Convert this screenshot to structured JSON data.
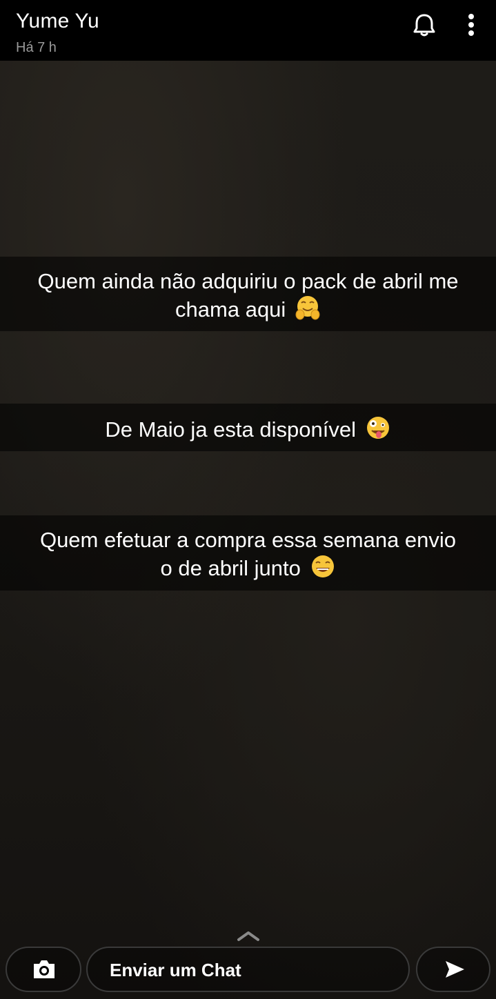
{
  "header": {
    "user_name": "Yume Yu",
    "timestamp": "Há 7 h",
    "icons": [
      "bell-icon",
      "more-vertical-icon"
    ]
  },
  "captions": [
    {
      "line1": "Quem ainda não adquiriu o pack de abril me",
      "line2": "chama aqui",
      "emoji": "hugging-face-emoji"
    },
    {
      "line1": "De Maio ja esta disponível",
      "emoji": "zany-face-emoji"
    },
    {
      "line1": "Quem efetuar a compra essa semana envio",
      "line2": "o de abril junto",
      "emoji": "grinning-squinting-face-emoji"
    }
  ],
  "footer": {
    "chat_placeholder": "Enviar um Chat",
    "icons": [
      "camera-icon",
      "send-icon",
      "chevron-up-icon"
    ]
  },
  "colors": {
    "header_bg": "#000000",
    "text": "#ffffff",
    "timestamp": "#9a9a9a",
    "caption_bg": "rgba(0,0,0,0.55)"
  }
}
